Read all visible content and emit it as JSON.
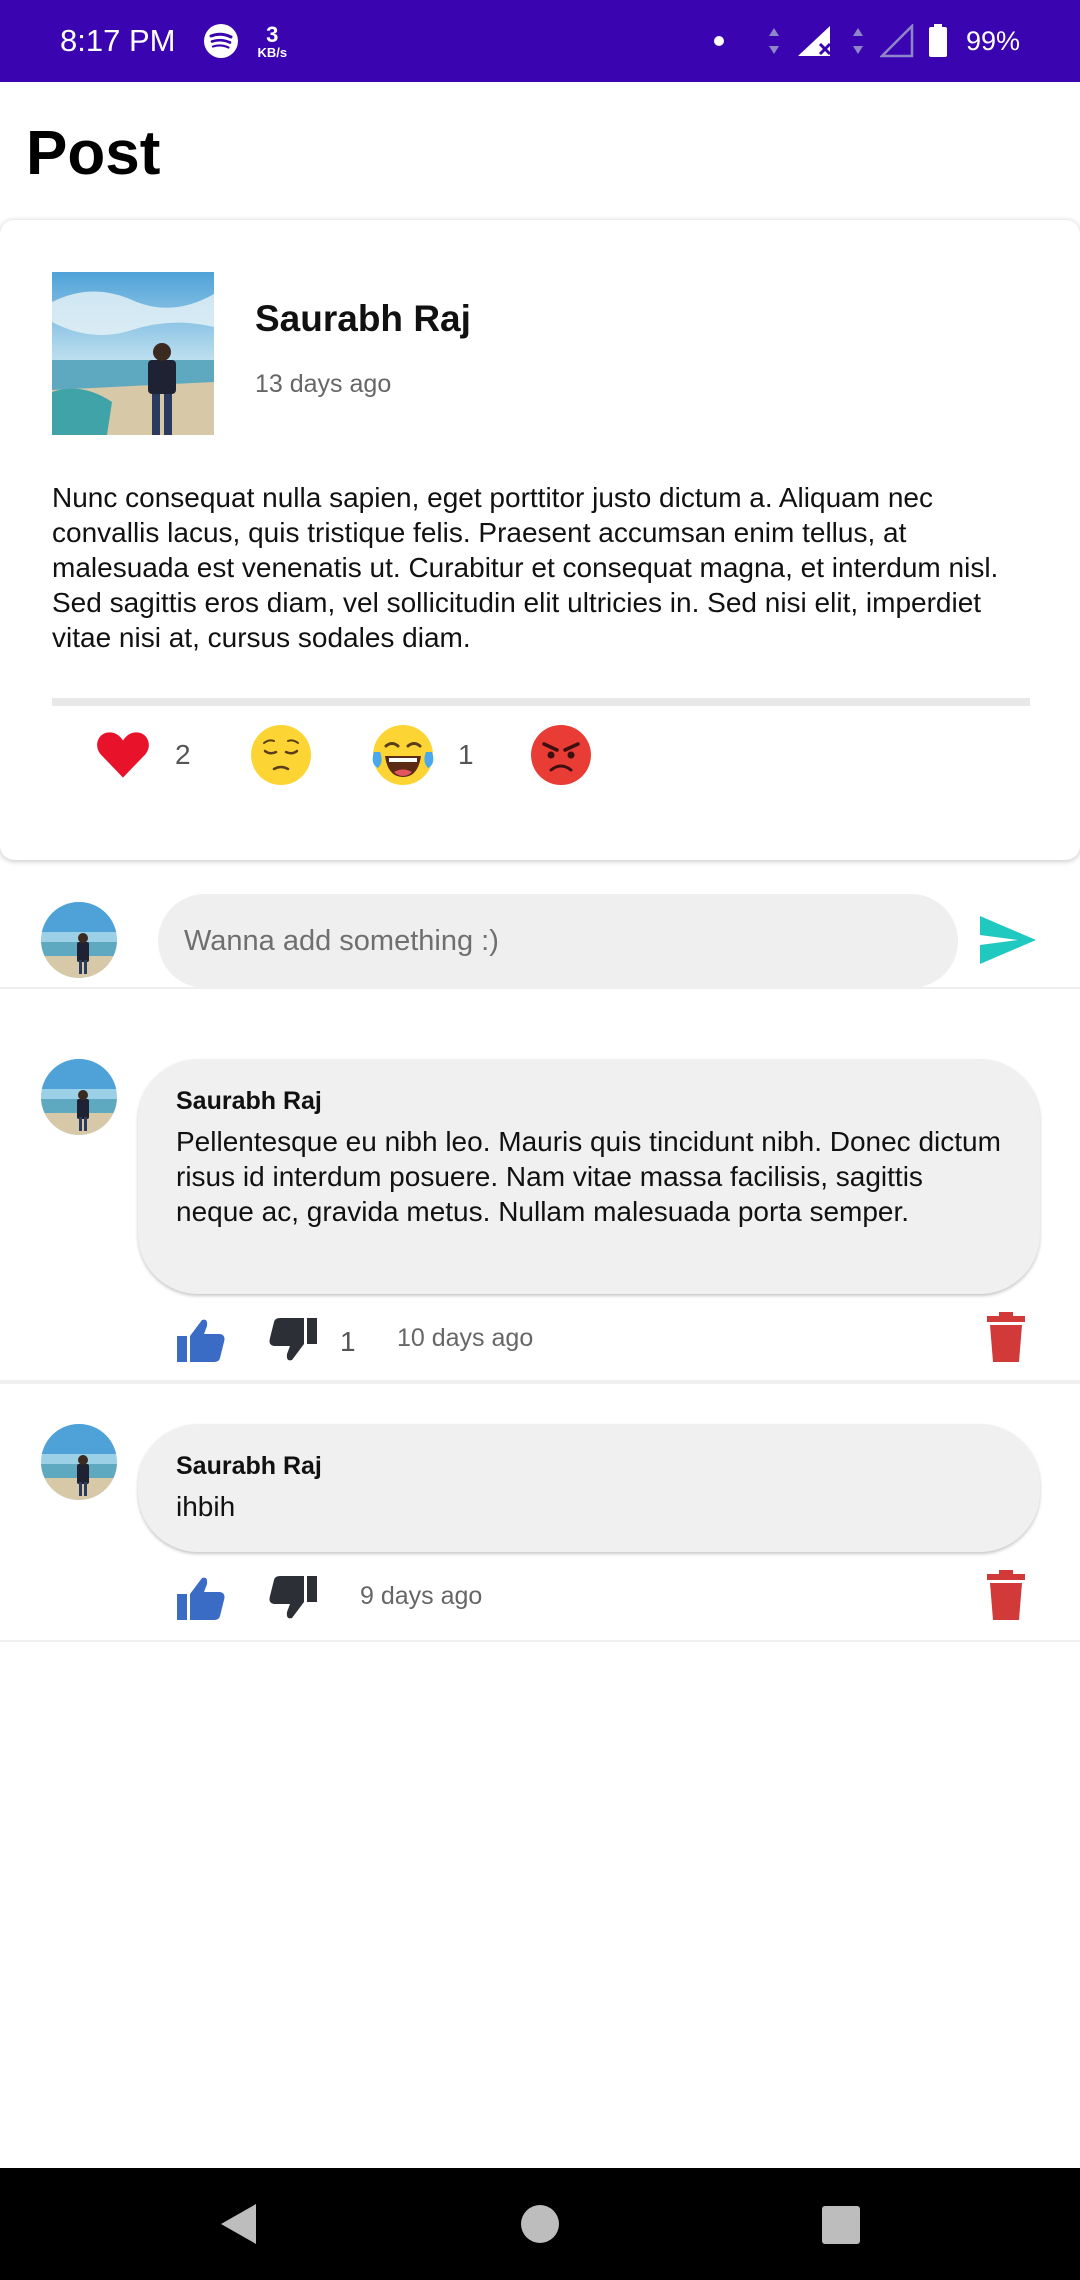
{
  "status_bar": {
    "time": "8:17 PM",
    "speed_value": "3",
    "speed_unit": "KB/s",
    "battery": "99%"
  },
  "header": {
    "title": "Post"
  },
  "post": {
    "author": "Saurabh Raj",
    "time": "13 days ago",
    "body": "Nunc consequat nulla sapien, eget porttitor justo dictum a. Aliquam nec convallis lacus, quis tristique felis. Praesent accumsan enim tellus, at malesuada est venenatis ut. Curabitur et consequat magna, et interdum nisl. Sed sagittis eros diam, vel sollicitudin elit ultricies in. Sed nisi elit, imperdiet vitae nisi at, cursus sodales diam.",
    "reactions": [
      {
        "icon": "heart-icon",
        "count": "2"
      },
      {
        "icon": "pensive-face-icon",
        "count": ""
      },
      {
        "icon": "laughing-tears-icon",
        "count": "1"
      },
      {
        "icon": "angry-face-icon",
        "count": ""
      }
    ]
  },
  "add_comment": {
    "placeholder": "Wanna add something :)",
    "send_icon": "send-icon"
  },
  "comments": [
    {
      "author": "Saurabh Raj",
      "text": "Pellentesque eu nibh leo. Mauris quis tincidunt nibh. Donec dictum risus id interdum posuere. Nam vitae massa facilisis, sagittis neque ac, gravida metus. Nullam malesuada porta semper.",
      "dislikes": "1",
      "time": "10 days ago"
    },
    {
      "author": "Saurabh Raj",
      "text": "ihbih",
      "dislikes": "",
      "time": "9 days ago"
    }
  ],
  "colors": {
    "status_bar": "#3a04b0",
    "like_blue": "#3b6cc5",
    "dislike_dark": "#2d2f36",
    "trash_red": "#d23a3a",
    "send_teal": "#1fc9c0",
    "heart_red": "#e8132b"
  }
}
